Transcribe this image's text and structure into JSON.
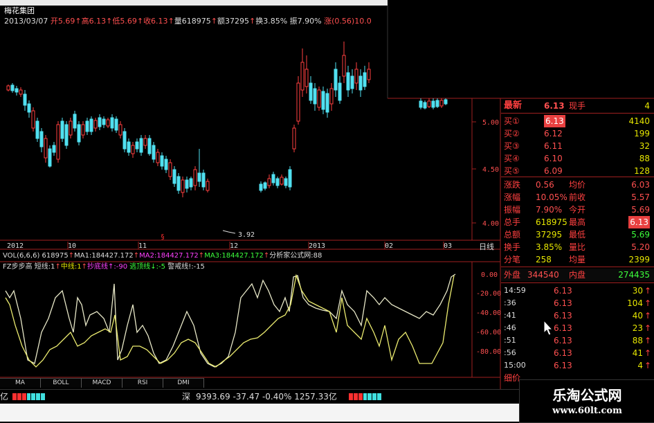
{
  "header": {
    "stock_name": "梅花集团",
    "quote_line": [
      {
        "text": "2013/03/07 ",
        "color": "#dddddd"
      },
      {
        "text": "开5.69",
        "color": "#ff5050"
      },
      {
        "text": "↑",
        "color": "#ff5050"
      },
      {
        "text": "高6.13",
        "color": "#ff5050"
      },
      {
        "text": "↑",
        "color": "#ff5050"
      },
      {
        "text": "低5.69",
        "color": "#ff5050"
      },
      {
        "text": "↑",
        "color": "#ff5050"
      },
      {
        "text": "收6.13",
        "color": "#ff5050"
      },
      {
        "text": "↑",
        "color": "#ff5050"
      },
      {
        "text": "量618975",
        "color": "#dddddd"
      },
      {
        "text": "↑",
        "color": "#ff5050"
      },
      {
        "text": "额37295",
        "color": "#dddddd"
      },
      {
        "text": "↑",
        "color": "#ff5050"
      },
      {
        "text": "换3.85%",
        "color": "#dddddd"
      },
      {
        "text": " 振7.90%",
        "color": "#dddddd"
      },
      {
        "text": " 涨(0.56)10.0",
        "color": "#ff5050"
      }
    ]
  },
  "price_axis": [
    "5.00",
    "4.50",
    "4.00"
  ],
  "low_marker": "3.92",
  "date_axis": [
    "2012",
    "10",
    "11",
    "12",
    "2013",
    "02",
    "03"
  ],
  "period_label": "日线",
  "vol_line": [
    {
      "text": "VOL(6,6,6) ",
      "color": "#dddddd"
    },
    {
      "text": "618975",
      "color": "#dddddd"
    },
    {
      "text": "↑",
      "color": "#ff5050"
    },
    {
      "text": "MA1:184427.172",
      "color": "#dddddd"
    },
    {
      "text": "↑",
      "color": "#ff5050"
    },
    {
      "text": "MA2:184427.172",
      "color": "#ff40ff"
    },
    {
      "text": "↑",
      "color": "#ff5050"
    },
    {
      "text": "MA3:184427.172",
      "color": "#3cff3c"
    },
    {
      "text": "↑",
      "color": "#ff5050"
    },
    {
      "text": "分析家公式网:88",
      "color": "#dddddd"
    }
  ],
  "fz_line": [
    {
      "text": "FZ步步高 ",
      "color": "#dddddd"
    },
    {
      "text": "短线:1",
      "color": "#dddddd"
    },
    {
      "text": "↑",
      "color": "#ff5050"
    },
    {
      "text": "中线:1",
      "color": "#e6e600"
    },
    {
      "text": "↑",
      "color": "#ff5050"
    },
    {
      "text": "抄底线↑:-90",
      "color": "#ff40ff"
    },
    {
      "text": " 逃顶线↓:-5",
      "color": "#3cff3c"
    },
    {
      "text": " 警戒线!:-15",
      "color": "#dddddd"
    }
  ],
  "indicator_axis": [
    "0.00",
    "-20.00",
    "-40.00",
    "-60.00",
    "-80.00"
  ],
  "indicator_tabs": [
    "MA",
    "BOLL",
    "MACD",
    "RSI",
    "DMI"
  ],
  "quote_panel": {
    "latest_label": "最新",
    "latest": "6.13",
    "hand_label": "现手",
    "hand": "4",
    "asks": [
      {
        "label": "买①",
        "price": "6.13",
        "vol": "4140"
      },
      {
        "label": "买②",
        "price": "6.12",
        "vol": "199"
      },
      {
        "label": "买③",
        "price": "6.11",
        "vol": "32"
      },
      {
        "label": "买④",
        "price": "6.10",
        "vol": "88"
      },
      {
        "label": "买⑤",
        "price": "6.09",
        "vol": "128"
      }
    ],
    "stats": [
      {
        "l1": "涨跌",
        "v1": "0.56",
        "l2": "均价",
        "v2": "6.03"
      },
      {
        "l1": "涨幅",
        "v1": "10.05%",
        "l2": "前收",
        "v2": "5.57"
      },
      {
        "l1": "振幅",
        "v1": "7.90%",
        "l2": "今开",
        "v2": "5.69"
      },
      {
        "l1": "总手",
        "v1": "618975",
        "l2": "最高",
        "v2": "6.13"
      },
      {
        "l1": "总额",
        "v1": "37295",
        "l2": "最低",
        "v2": "5.69"
      },
      {
        "l1": "换手",
        "v1": "3.85%",
        "l2": "量比",
        "v2": "5.20"
      },
      {
        "l1": "分笔",
        "v1": "258",
        "l2": "均量",
        "v2": "2399"
      }
    ],
    "outer_label": "外盘",
    "outer": "344540",
    "inner_label": "内盘",
    "inner": "274435",
    "ticks": [
      {
        "time": "14:59",
        "price": "6.13",
        "vol": "30"
      },
      {
        "time": ":36",
        "price": "6.13",
        "vol": "104"
      },
      {
        "time": ":41",
        "price": "6.13",
        "vol": "40"
      },
      {
        "time": ":46",
        "price": "6.13",
        "vol": "23"
      },
      {
        "time": ":51",
        "price": "6.13",
        "vol": "88"
      },
      {
        "time": ":56",
        "price": "6.13",
        "vol": "41"
      },
      {
        "time": "15:00",
        "price": "6.13",
        "vol": "4"
      }
    ],
    "footer_label": "细价"
  },
  "status_bar": {
    "prefix": "亿",
    "sz_label": "深",
    "sz_index": "9393.69",
    "sz_change": "-37.47",
    "sz_pct": "-0.40%",
    "sz_amount": "1257.33亿"
  },
  "watermark": {
    "title": "乐淘公式网",
    "url": "www.60lt.com"
  }
}
